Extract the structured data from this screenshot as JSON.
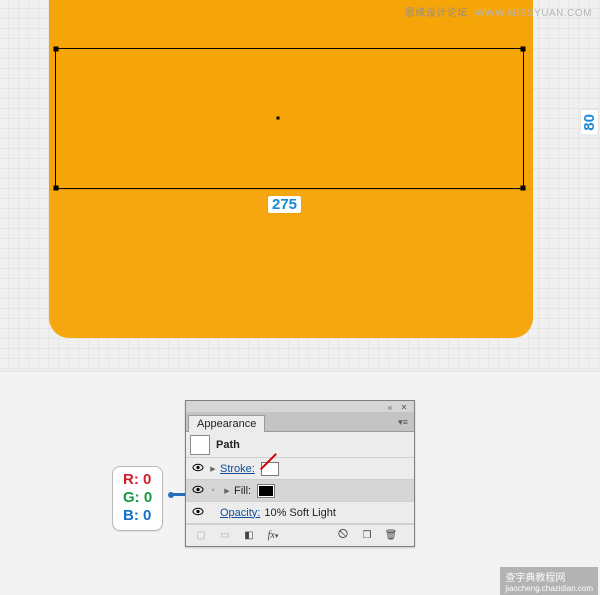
{
  "watermark_top": {
    "cn": "思缘设计论坛",
    "url": "WWW.MISSYUAN.COM"
  },
  "watermark_bottom": {
    "cn": "查字典教程网",
    "url": "jiaocheng.chazidian.com"
  },
  "canvas": {
    "selection_width_label": "275",
    "selection_height_label": "80"
  },
  "appearance_panel": {
    "tab_label": "Appearance",
    "object_label": "Path",
    "stroke_label": "Stroke:",
    "fill_label": "Fill:",
    "opacity_label": "Opacity:",
    "opacity_value": "10% Soft Light",
    "footer_icons": {
      "add_stroke": "add-stroke",
      "add_fill": "add-fill",
      "fx": "fx",
      "clear": "clear",
      "duplicate": "duplicate",
      "delete": "delete"
    }
  },
  "rgb_callout": {
    "r_label": "R:",
    "r_value": "0",
    "g_label": "G:",
    "g_value": "0",
    "b_label": "B:",
    "b_value": "0"
  }
}
